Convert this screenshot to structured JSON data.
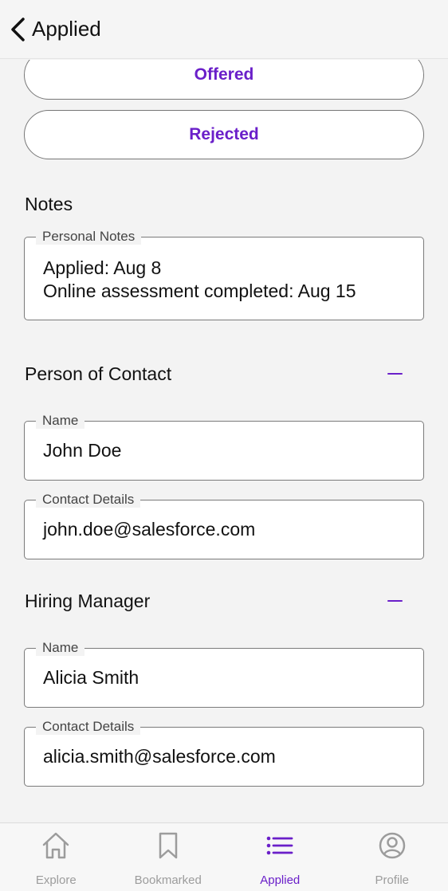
{
  "header": {
    "title": "Applied"
  },
  "status_options": {
    "offered": "Offered",
    "rejected": "Rejected"
  },
  "notes": {
    "section_title": "Notes",
    "field_label": "Personal Notes",
    "lines": [
      "Applied: Aug 8",
      "Online assessment completed: Aug 15"
    ]
  },
  "contact": {
    "section_title": "Person of Contact",
    "name_label": "Name",
    "name_value": "John Doe",
    "details_label": "Contact Details",
    "details_value": "john.doe@salesforce.com"
  },
  "hiring_manager": {
    "section_title": "Hiring Manager",
    "name_label": "Name",
    "name_value": "Alicia Smith",
    "details_label": "Contact Details",
    "details_value": "alicia.smith@salesforce.com"
  },
  "tabbar": {
    "items": [
      {
        "label": "Explore",
        "icon": "house-icon"
      },
      {
        "label": "Bookmarked",
        "icon": "bookmark-icon"
      },
      {
        "label": "Applied",
        "icon": "list-icon",
        "active": true
      },
      {
        "label": "Profile",
        "icon": "person-circle-icon"
      }
    ]
  },
  "colors": {
    "accent": "#6a1fc9",
    "inactive": "#9c9c9c",
    "background": "#f3f3f3"
  }
}
